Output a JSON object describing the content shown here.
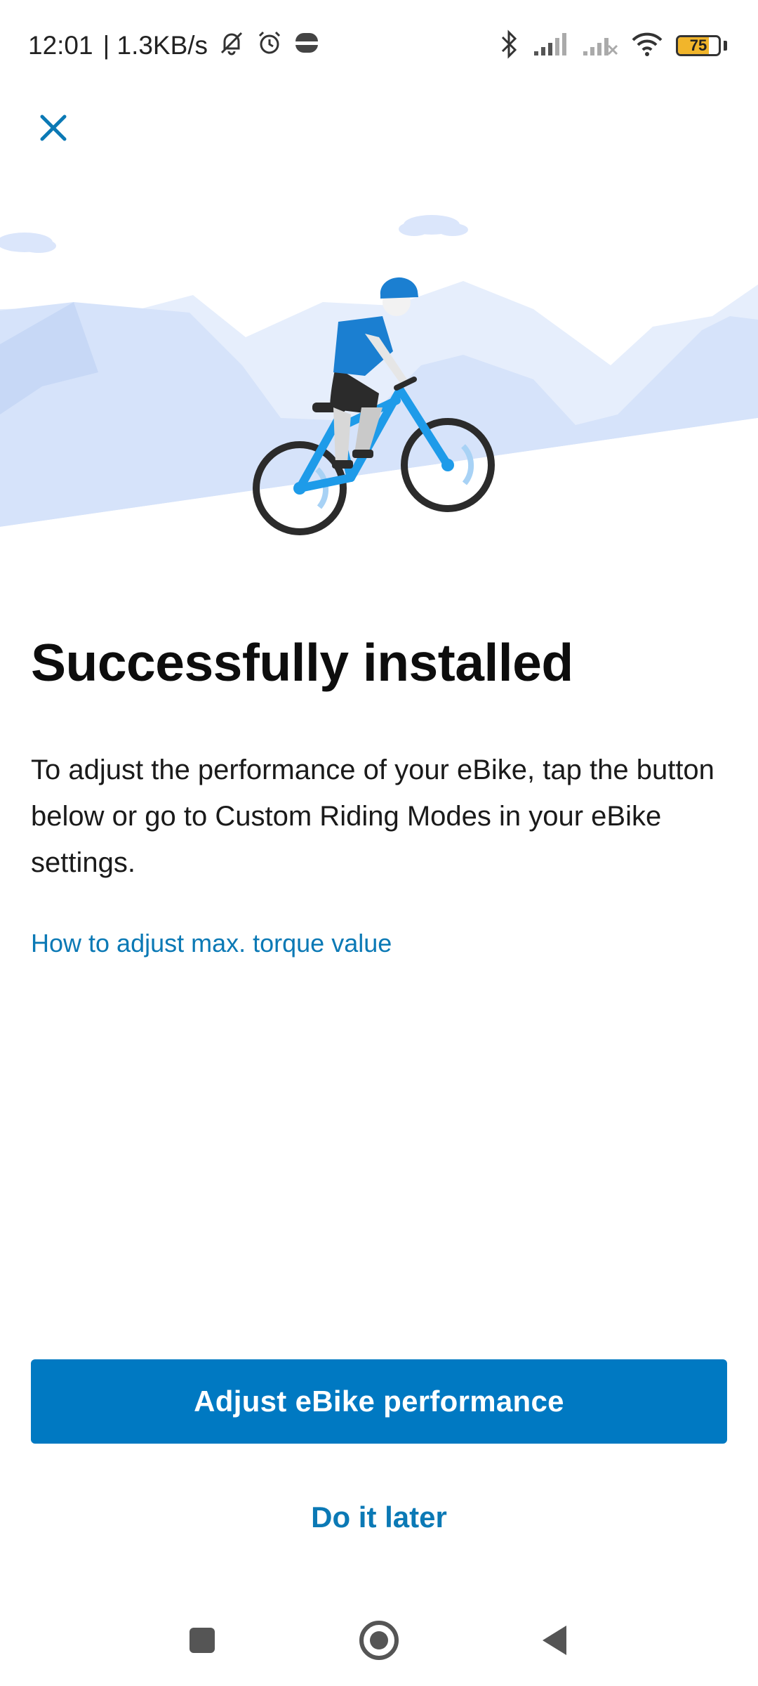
{
  "status_bar": {
    "time": "12:01",
    "network_speed": "| 1.3KB/s",
    "battery_level": "75",
    "battery_fraction": 0.75,
    "icons": [
      "mute-icon",
      "alarm-icon",
      "burger-king-icon",
      "bluetooth-icon",
      "signal-icon",
      "signal-no-service-icon",
      "wifi-icon",
      "battery-icon"
    ]
  },
  "header": {
    "close_icon": "close-icon"
  },
  "hero": {
    "illustration": "ebike-rider-illustration"
  },
  "main": {
    "title": "Successfully installed",
    "description": "To adjust the performance of your eBike, tap the button below or go to Custom Riding Modes in your eBike settings.",
    "help_link": "How to adjust max. torque value"
  },
  "actions": {
    "primary_label": "Adjust eBike performance",
    "secondary_label": "Do it later"
  },
  "navigation": {
    "icons": [
      "recents-icon",
      "home-icon",
      "back-icon"
    ]
  },
  "colors": {
    "accent": "#0079c2",
    "link": "#0b79b5",
    "bike": "#1e9be9",
    "mountains": "#dbe6fb"
  }
}
